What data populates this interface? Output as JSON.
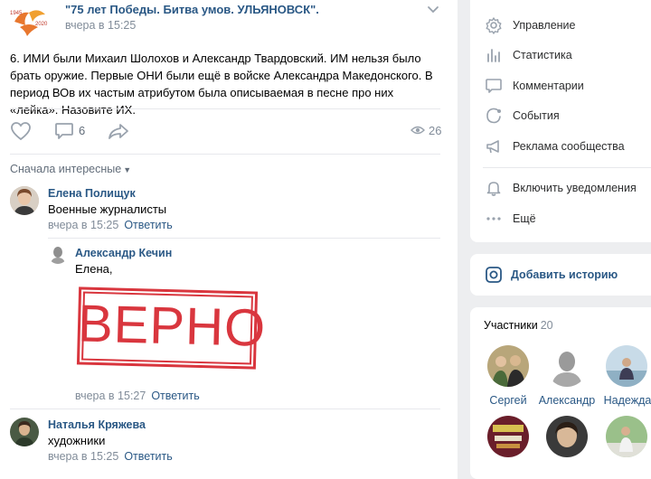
{
  "post": {
    "group_title": "\"75 лет Победы. Битва умов. УЛЬЯНОВСК\".",
    "time": "вчера в 15:25",
    "text": "6. ИМИ были Михаил Шолохов и Александр Твардовский. ИМ нельзя было брать оружие. Первые ОНИ были ещё в войске Александра Македонского. В период ВОв их частым атрибутом была описываемая в песне про них «лейка». Назовите ИХ.",
    "comments_count": "6",
    "views_count": "26",
    "logo_text_left": "1945",
    "logo_text_right": "2020"
  },
  "comments": {
    "sort_label": "Сначала интересные",
    "items": [
      {
        "author": "Елена Полищук",
        "text": "Военные журналисты",
        "time": "вчера в 15:25",
        "reply": "Ответить"
      },
      {
        "author": "Александр Кечин",
        "text": "Елена,",
        "time": "вчера в 15:27",
        "reply": "Ответить",
        "stamp": "ВЕРНО"
      },
      {
        "author": "Наталья Кряжева",
        "text": "художники",
        "time": "вчера в 15:25",
        "reply": "Ответить"
      }
    ]
  },
  "menu": {
    "items": [
      {
        "label": "Управление",
        "icon": "gear-icon"
      },
      {
        "label": "Статистика",
        "icon": "stats-icon"
      },
      {
        "label": "Комментарии",
        "icon": "comment-icon"
      },
      {
        "label": "События",
        "icon": "events-icon"
      },
      {
        "label": "Реклама сообщества",
        "icon": "megaphone-icon"
      },
      {
        "label": "Включить уведомления",
        "icon": "bell-icon"
      },
      {
        "label": "Ещё",
        "icon": "more-icon"
      }
    ]
  },
  "story": {
    "label": "Добавить историю",
    "icon": "instagram-icon"
  },
  "members": {
    "title": "Участники",
    "count": "20",
    "people": [
      {
        "name": "Сергей"
      },
      {
        "name": "Александр"
      },
      {
        "name": "Надежда"
      }
    ]
  },
  "colors": {
    "link": "#2a5885",
    "stamp": "#d9363e",
    "bg": "#edeef0"
  }
}
